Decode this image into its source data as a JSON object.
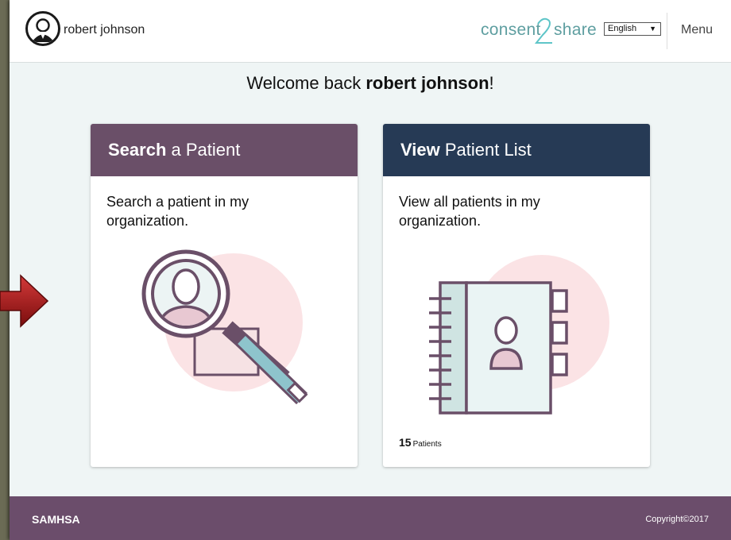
{
  "header": {
    "username": "robert johnson",
    "brand_left": "consent",
    "brand_mid": "2",
    "brand_right": "share",
    "language": "English",
    "menu_label": "Menu"
  },
  "welcome": {
    "prefix": "Welcome back ",
    "name": "robert johnson",
    "suffix": "!"
  },
  "cards": [
    {
      "title_bold": "Search",
      "title_rest": " a Patient",
      "description": "Search a patient in my organization.",
      "illustration": "magnifier-person-icon",
      "header_color": "#6a4f68"
    },
    {
      "title_bold": "View",
      "title_rest": " Patient List",
      "description": "View all patients in my organization.",
      "illustration": "address-book-icon",
      "header_color": "#263a55",
      "count_value": "15",
      "count_unit": "Patients"
    }
  ],
  "footer": {
    "org": "SAMHSA",
    "copyright": "Copyright©2017"
  },
  "colors": {
    "accent_purple": "#6a4f68",
    "accent_navy": "#263a55",
    "brand_teal": "#5e9ea0",
    "illus_pink": "#fbe3e5",
    "arrow_red": "#a01818"
  }
}
